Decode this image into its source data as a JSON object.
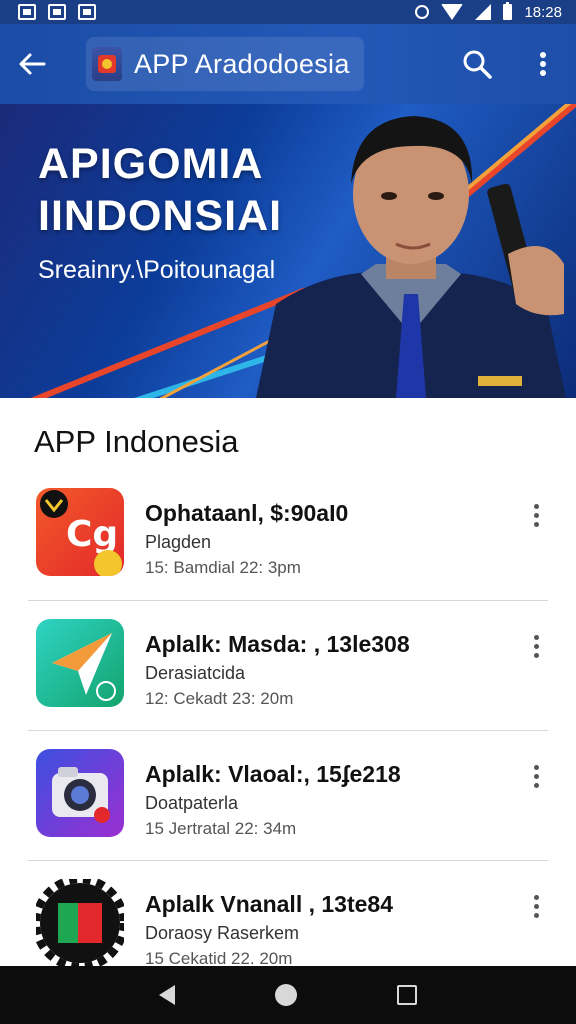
{
  "status_bar": {
    "time": "18:28"
  },
  "app_bar": {
    "title": "APP Aradodoesia"
  },
  "banner": {
    "title_line1": "APIGOMIA",
    "title_line2": "IINDONSIAI",
    "subtitle": "Sreainry.\\Poitounagal"
  },
  "section": {
    "title": "APP Indonesia"
  },
  "list": [
    {
      "title": "Ophataanl, $:90aI0",
      "subtitle": "Plagden",
      "time": "15: Bamdial 22: 3pm"
    },
    {
      "title": "Aplalk: Masda: , 13le308",
      "subtitle": "Derasiatcida",
      "time": "12: Cekadt 23: 20m"
    },
    {
      "title": "Aplalk: Vlaoal:, 15ʄe218",
      "subtitle": "Doatpaterla",
      "time": "15 Jertratal 22: 34m"
    },
    {
      "title": "Aplalk Vnanall , 13te84",
      "subtitle": "Doraosy Raserkem",
      "time": "15 Cekatid 22. 20m"
    }
  ],
  "colors": {
    "app_bar": "#2358b8",
    "status_bar": "#1a3f86",
    "banner_bg": "#0c3d9a",
    "nav_bar": "#0c0c0c"
  }
}
